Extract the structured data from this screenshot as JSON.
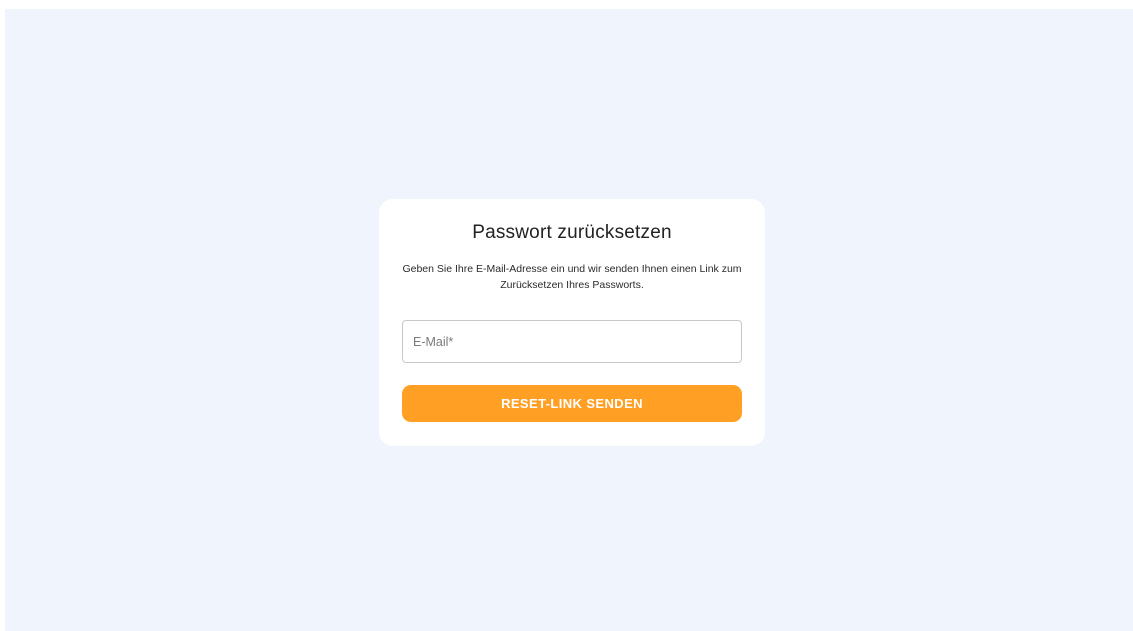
{
  "reset_card": {
    "title": "Passwort zurücksetzen",
    "description": "Geben Sie Ihre E-Mail-Adresse ein und wir senden Ihnen einen Link zum Zurücksetzen Ihres Passworts.",
    "email_field": {
      "placeholder": "E-Mail*",
      "value": ""
    },
    "submit_label": "RESET-LINK SENDEN"
  },
  "colors": {
    "background": "#f0f4fd",
    "card": "#ffffff",
    "accent": "#ff9f24"
  }
}
